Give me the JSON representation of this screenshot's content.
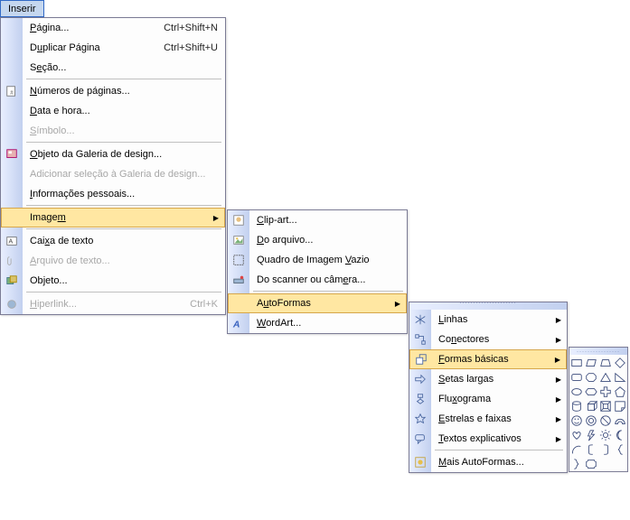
{
  "menu_tab": {
    "label": "Inserir"
  },
  "main": {
    "pagina": {
      "label": "Página...",
      "shortcut": "Ctrl+Shift+N"
    },
    "duplicar": {
      "label": "Duplicar Página",
      "shortcut": "Ctrl+Shift+U"
    },
    "secao": {
      "label": "Seção..."
    },
    "numeros": {
      "label": "Números de páginas..."
    },
    "datahora": {
      "label": "Data e hora..."
    },
    "simbolo": {
      "label": "Símbolo..."
    },
    "objgal": {
      "label": "Objeto da Galeria de design..."
    },
    "addsel": {
      "label": "Adicionar seleção à Galeria de design..."
    },
    "infop": {
      "label": "Informações pessoais..."
    },
    "imagem": {
      "label": "Imagem"
    },
    "caixa": {
      "label": "Caixa de texto"
    },
    "arquivo": {
      "label": "Arquivo de texto..."
    },
    "objeto": {
      "label": "Objeto..."
    },
    "hyperlink": {
      "label": "Hiperlink...",
      "shortcut": "Ctrl+K"
    }
  },
  "imagemenu": {
    "clipart": {
      "label": "Clip-art..."
    },
    "doarquivo": {
      "label": "Do arquivo..."
    },
    "quadro": {
      "label": "Quadro de Imagem Vazio"
    },
    "scanner": {
      "label": "Do scanner ou câmera..."
    },
    "autoformas": {
      "label": "AutoFormas"
    },
    "wordart": {
      "label": "WordArt..."
    }
  },
  "automenu": {
    "linhas": {
      "label": "Linhas"
    },
    "conectores": {
      "label": "Conectores"
    },
    "formasbasicas": {
      "label": "Formas básicas"
    },
    "setaslargas": {
      "label": "Setas largas"
    },
    "fluxograma": {
      "label": "Fluxograma"
    },
    "estrelas": {
      "label": "Estrelas e faixas"
    },
    "textos": {
      "label": "Textos explicativos"
    },
    "mais": {
      "label": "Mais AutoFormas..."
    }
  }
}
